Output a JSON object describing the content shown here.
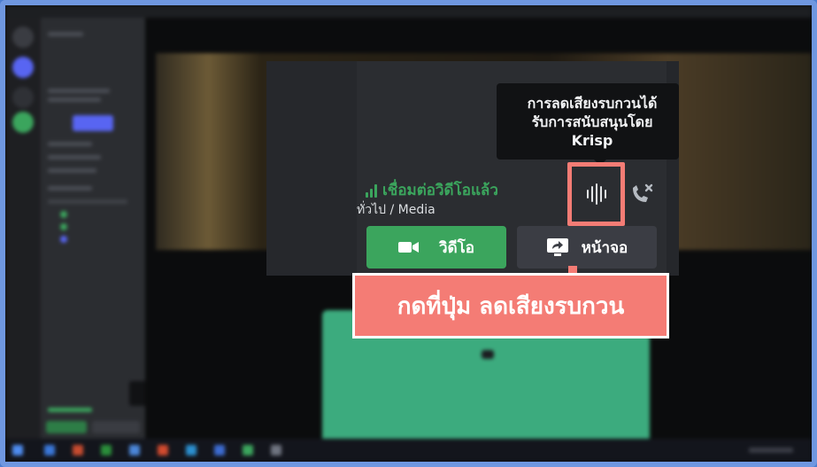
{
  "tooltip": {
    "lines": [
      "การลดเสียงรบกวนได้",
      "รับการสนับสนุนโดย",
      "Krisp"
    ]
  },
  "voice_panel": {
    "status": "เชื่อมต่อวิดีโอแล้ว",
    "channel_path": "ทั่วไป / Media",
    "video_button_label": "วิดีโอ",
    "screen_button_label": "หน้าจอ",
    "icons": {
      "signal": "signal-strength-icon",
      "krisp": "noise-suppression-icon",
      "disconnect": "disconnect-call-icon",
      "video": "camera-icon",
      "screen": "screen-share-icon"
    }
  },
  "callout": {
    "text": "กดที่ปุ่ม ลดเสียงรบกวน"
  },
  "colors": {
    "accent_green": "#3ba55d",
    "highlight": "#f47c75",
    "panel_bg": "#2b2d31",
    "tooltip_bg": "#111214",
    "frame": "#6f97e0"
  }
}
